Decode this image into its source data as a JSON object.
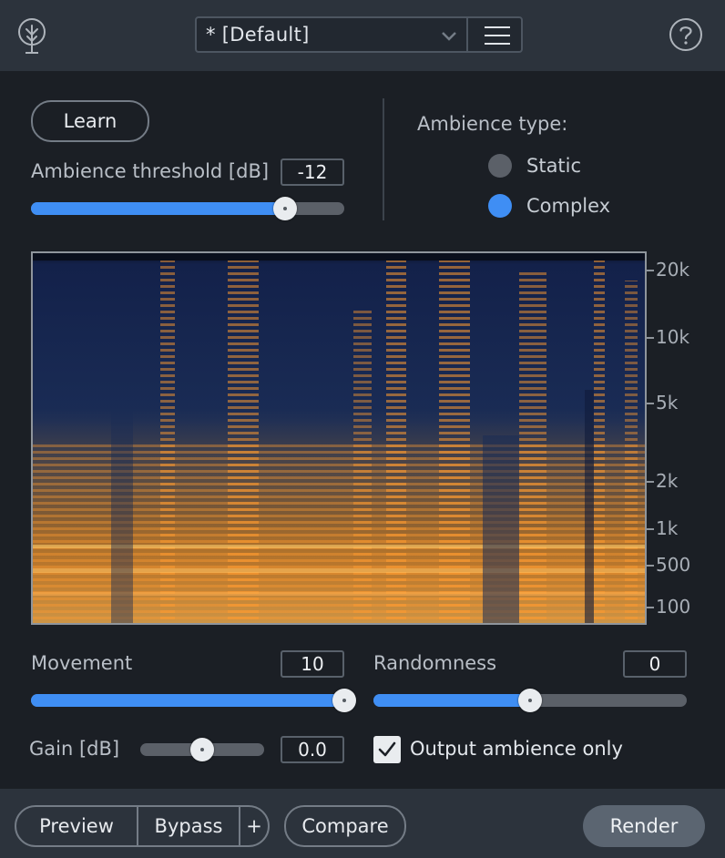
{
  "header": {
    "preset_name": "* [Default]",
    "logo_icon": "tree-logo-icon",
    "dropdown_icon": "chevron-down-icon",
    "menu_icon": "hamburger-menu-icon",
    "help_icon": "help-icon"
  },
  "controls": {
    "learn_label": "Learn",
    "ambience_threshold_label": "Ambience threshold [dB]",
    "ambience_threshold_value": "-12",
    "ambience_threshold_fraction": 0.81,
    "ambience_type_label": "Ambience type:",
    "ambience_type_options": [
      "Static",
      "Complex"
    ],
    "ambience_type_selected": "Complex",
    "movement_label": "Movement",
    "movement_value": "10",
    "movement_fraction": 1.0,
    "randomness_label": "Randomness",
    "randomness_value": "0",
    "randomness_fraction": 0.5,
    "gain_label": "Gain [dB]",
    "gain_value": "0.0",
    "gain_fraction": 0.5,
    "output_ambience_only_label": "Output ambience only",
    "output_ambience_only_checked": true
  },
  "spectrogram": {
    "frequency_labels": [
      "20k",
      "10k",
      "5k",
      "2k",
      "1k",
      "500",
      "100"
    ]
  },
  "footer": {
    "preview_label": "Preview",
    "bypass_label": "Bypass",
    "plus_label": "+",
    "compare_label": "Compare",
    "render_label": "Render"
  },
  "colors": {
    "accent": "#3f8ef4",
    "panel": "#2c333c",
    "background": "#1b1f25",
    "spectrogram_low": "#0f1a3a",
    "spectrogram_high": "#ffb040"
  }
}
